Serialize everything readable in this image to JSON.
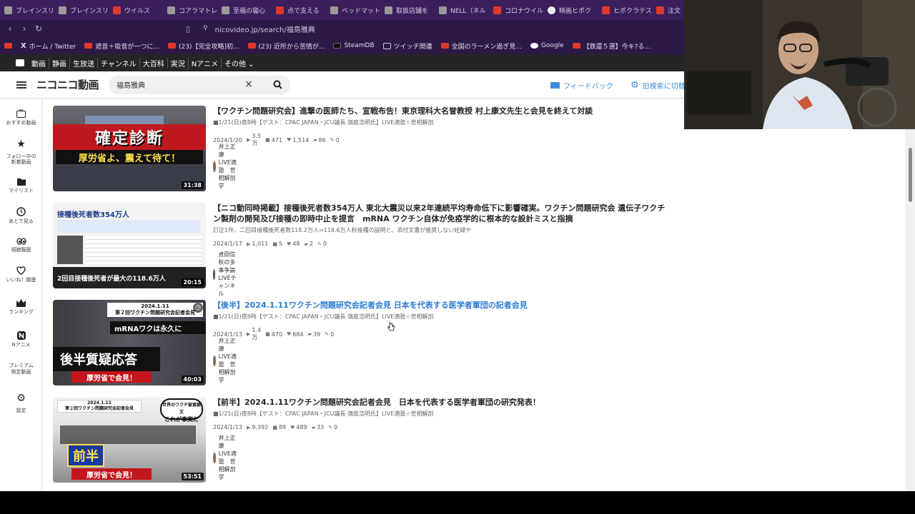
{
  "browser": {
    "tabs": [
      {
        "label": "ブレインスリー",
        "icon": "gray"
      },
      {
        "label": "ブレインスリー",
        "icon": "gray"
      },
      {
        "label": "ウイルス",
        "icon": "red"
      },
      {
        "label": "コアラマトレ",
        "icon": "gray"
      },
      {
        "label": "至福の寝心",
        "icon": "gray"
      },
      {
        "label": "点で支える",
        "icon": "red"
      },
      {
        "label": "ベッドマット",
        "icon": "gray"
      },
      {
        "label": "取扱店舗を",
        "icon": "gray"
      },
      {
        "label": "NELL（ネル",
        "icon": "gray"
      },
      {
        "label": "コロナウイルス",
        "icon": "red"
      },
      {
        "label": "映画ヒポク",
        "icon": "white"
      },
      {
        "label": "ヒポクラテスの",
        "icon": "red"
      },
      {
        "label": "注文",
        "icon": "red"
      }
    ],
    "url": "nicovideo.jp/search/福島雅典",
    "bookmarks": [
      {
        "label": "",
        "icon": "red"
      },
      {
        "label": "ホーム / Twitter",
        "icon": "black"
      },
      {
        "label": "遮音＋吸音が一つに...",
        "icon": "red"
      },
      {
        "label": "(23)【完全攻略]初...",
        "icon": "red"
      },
      {
        "label": "(23) 近所から苦情が...",
        "icon": "red"
      },
      {
        "label": "SteamDB",
        "icon": "black"
      },
      {
        "label": "ツイッチ関連",
        "icon": "folder"
      },
      {
        "label": "全国のラーメン過ぎ見...",
        "icon": "red"
      },
      {
        "label": "Google",
        "icon": "red"
      },
      {
        "label": "【鉄還５選】今キ?る...",
        "icon": "red"
      }
    ]
  },
  "nicobar": {
    "items": [
      "動画",
      "静画",
      "生放送",
      "チャンネル",
      "大百科",
      "実況",
      "Nアニメ",
      "その他 ⌄"
    ]
  },
  "header": {
    "logo": "ニコニコ動画",
    "search_value": "福島雅典",
    "feedback": "フィードバック",
    "old_search": "旧検索に切替"
  },
  "sidebar": {
    "items": [
      {
        "label": "おすすめ動画",
        "icon": "tv-icon"
      },
      {
        "label": "フォロー中の\n新着動画",
        "icon": "star-icon"
      },
      {
        "label": "マイリスト",
        "icon": "folder-icon"
      },
      {
        "label": "あとで見る",
        "icon": "clock-icon"
      },
      {
        "label": "視聴履歴",
        "icon": "eyes-icon"
      },
      {
        "label": "いいね！履歴",
        "icon": "heart-icon"
      },
      {
        "label": "ランキング",
        "icon": "crown-icon"
      },
      {
        "label": "Nアニメ",
        "icon": "n-anime-icon"
      },
      {
        "label": "プレミアム\n限定動画",
        "icon": "premium-icon"
      },
      {
        "label": "設定",
        "icon": "gear-icon"
      }
    ]
  },
  "videos": [
    {
      "title": "【ワクチン問題研究会】進撃の医師たち、宣戦布告！東京理科大名誉教授 村上康文先生と会見を終えて対談",
      "desc": "■1/21(日)夜8時【ゲスト：CPAC JAPAN・JCU議長 嶺庭浩明氏】LIVE適塾☆世相解剖",
      "date": "2024/1/20",
      "views": "3.5万",
      "comments": "471",
      "likes": "1,514",
      "mylists": "86",
      "ads": "0",
      "owner": "井上正康　LIVE適塾　世相解剖学",
      "duration": "31:38",
      "thumb_text": "確定診断",
      "thumb_sub": "厚労省よ、震えて待て！",
      "title_color": "dark"
    },
    {
      "title": "【ニコ動同時掲載】接種後死者数354万人 東北大震災以来2年連続平均寿命低下に影響確実。ワクチン問題研究会 遺伝子ワクチン製剤の開発及び接種の即時中止を提言　mRNA ワクチン自体が免疫学的に根本的な設計ミスと指摘",
      "desc": "訂正1件、二回目接種後死者数118.2万人⇒118.6万人秋接種の説明と、添付文書が推奨しない妊婦や",
      "date": "2024/1/17",
      "views": "1,011",
      "comments": "5",
      "likes": "48",
      "mylists": "2",
      "ads": "0",
      "owner": "貞田信秋の多事争論 LIVEチャンネル",
      "duration": "20:15",
      "thumb_text": "接種後死者数354万人",
      "thumb_sub": "2回目接種後死者が最大の118.6万人",
      "title_color": "dark"
    },
    {
      "title": "【後半】2024.1.11ワクチン問題研究会記者会見 日本を代表する医学者軍団の記者会見",
      "desc": "■1/21(日)夜8時【ゲスト：CPAC JAPAN・JCU議長 嶺庭浩明氏】LIVE適塾☆世相解剖",
      "date": "2024/1/13",
      "views": "1.4万",
      "comments": "470",
      "likes": "684",
      "mylists": "39",
      "ads": "0",
      "owner": "井上正康　LIVE適塾　世相解剖学",
      "duration": "40:03",
      "thumb_text": "後半質疑応答",
      "thumb_sub": "厚労省で会見！",
      "title_color": "blue"
    },
    {
      "title": "【前半】2024.1.11ワクチン問題研究会記者会見　日本を代表する医学者軍団の研究発表！",
      "desc": "■1/21(日)夜8時【ゲスト：CPAC JAPAN・JCU議長 嶺庭浩明氏】LIVE適塾☆世相解剖",
      "date": "2024/1/13",
      "views": "9,392",
      "comments": "89",
      "likes": "489",
      "mylists": "33",
      "ads": "0",
      "owner": "井上正康　LIVE適塾　世相解剖学",
      "duration": "53:51",
      "thumb_text": "前半",
      "thumb_sub": "厚労省で会見！",
      "title_color": "dark"
    }
  ],
  "thumb_labels": {
    "v2_top": "2回目接種後死者が最大の",
    "v3_banner": "第２回ワクチン問題研究会記者会見",
    "v3_date": "2024.1.11",
    "v3_mrna": "mRNAワクは永久に",
    "v4_date": "2024.1.11",
    "v4_banner": "第２回ワクチン問題研究会記者会見",
    "v4_bubble1": "世界のワクチ被害論文",
    "v4_bubble2": "これが事実だ"
  },
  "colors": {
    "accent_blue": "#2a7bd4",
    "tab_bg": "#3a1f5c",
    "chrome_bg": "#2c1947",
    "nico_bar": "#252525"
  }
}
